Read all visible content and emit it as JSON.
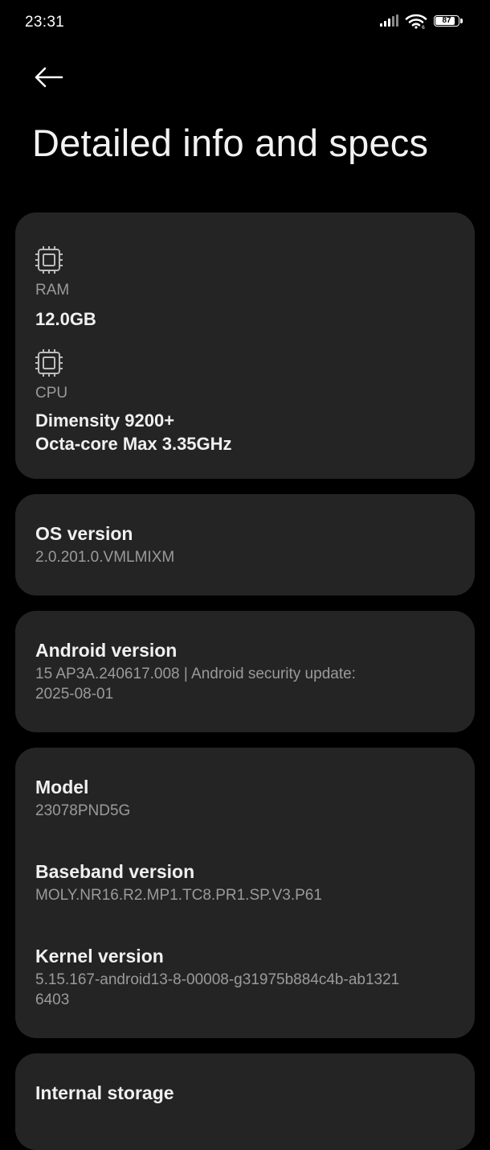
{
  "status_bar": {
    "time": "23:31",
    "battery_level": "87",
    "battery_fraction": 0.87,
    "icons": [
      "signal-icon",
      "wifi-icon",
      "battery-icon"
    ]
  },
  "header": {
    "back_icon": "arrow-left-icon",
    "title": "Detailed info and specs"
  },
  "hardware": {
    "ram": {
      "icon": "chip-icon",
      "label": "RAM",
      "value": "12.0GB"
    },
    "cpu": {
      "icon": "chip-icon",
      "label": "CPU",
      "value_line1": "Dimensity 9200+",
      "value_line2": "Octa-core Max 3.35GHz"
    }
  },
  "os_version": {
    "title": "OS version",
    "value": "2.0.201.0.VMLMIXM"
  },
  "android_version": {
    "title": "Android version",
    "value_line1": "15 AP3A.240617.008 | Android security update:",
    "value_line2": "2025-08-01"
  },
  "device": {
    "model": {
      "title": "Model",
      "value": "23078PND5G"
    },
    "baseband": {
      "title": "Baseband version",
      "value": "MOLY.NR16.R2.MP1.TC8.PR1.SP.V3.P61"
    },
    "kernel": {
      "title": "Kernel version",
      "value_line1": "5.15.167-android13-8-00008-g31975b884c4b-ab1321",
      "value_line2": "6403"
    }
  },
  "storage": {
    "title": "Internal storage"
  },
  "colors": {
    "background": "#000000",
    "card": "#242424",
    "primary_text": "#f0f0f0",
    "secondary_text": "#9a9a9a"
  }
}
